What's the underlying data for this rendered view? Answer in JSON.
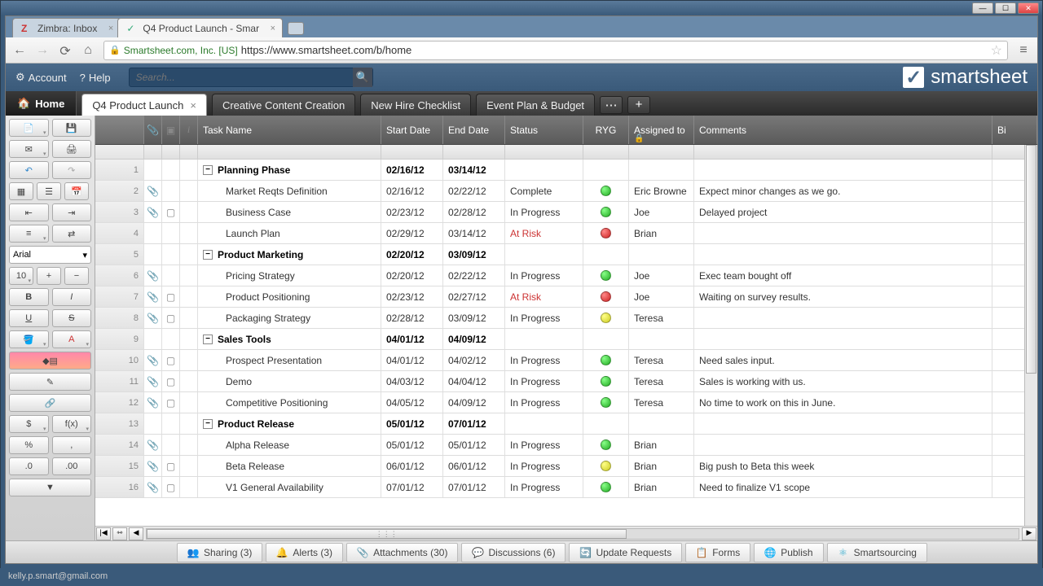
{
  "window": {
    "min": "—",
    "max": "☐",
    "close": "✕"
  },
  "browser_tabs": [
    {
      "title": "Zimbra: Inbox",
      "active": false,
      "icon": "Z"
    },
    {
      "title": "Q4 Product Launch - Smar",
      "active": true,
      "icon": "✓"
    }
  ],
  "nav": {
    "back": "←",
    "fwd": "→",
    "reload": "⟳",
    "home": "⌂"
  },
  "url": {
    "ev": "Smartsheet.com, Inc. [US]",
    "addr": "https://www.smartsheet.com/b/home"
  },
  "app_top": {
    "account": "Account",
    "help": "Help",
    "search_placeholder": "Search...",
    "logo": "smartsheet"
  },
  "sheet_tabs": {
    "home": "Home",
    "tabs": [
      {
        "label": "Q4 Product Launch",
        "active": true
      },
      {
        "label": "Creative Content Creation",
        "active": false
      },
      {
        "label": "New Hire Checklist",
        "active": false
      },
      {
        "label": "Event Plan & Budget",
        "active": false
      }
    ]
  },
  "toolbar": {
    "font": "Arial",
    "size": "10",
    "bold": "B",
    "italic": "I",
    "underline": "U",
    "strike": "S",
    "currency": "$",
    "fx": "f(x)",
    "percent": "%",
    "comma": ",",
    "dec_dec": ".0",
    "dec_inc": ".00",
    "link": "🔗",
    "highlight": "✎",
    "arrow": "▾"
  },
  "columns": {
    "rownum": "",
    "attach": "📎",
    "discuss": "▣",
    "info": "i",
    "task": "Task Name",
    "start": "Start Date",
    "end": "End Date",
    "status": "Status",
    "ryg": "RYG",
    "assigned": "Assigned to",
    "comments": "Comments",
    "extra": "Bi"
  },
  "rows": [
    {
      "n": 1,
      "parent": true,
      "task": "Planning Phase",
      "start": "02/16/12",
      "end": "03/14/12"
    },
    {
      "n": 2,
      "att": true,
      "task": "Market Reqts Definition",
      "start": "02/16/12",
      "end": "02/22/12",
      "status": "Complete",
      "ryg": "g",
      "assigned": "Eric Browne",
      "comment": "Expect minor changes as we go."
    },
    {
      "n": 3,
      "att": true,
      "disc": true,
      "task": "Business Case",
      "start": "02/23/12",
      "end": "02/28/12",
      "status": "In Progress",
      "ryg": "g",
      "assigned": "Joe",
      "comment": "Delayed project"
    },
    {
      "n": 4,
      "task": "Launch Plan",
      "start": "02/29/12",
      "end": "03/14/12",
      "status": "At Risk",
      "risk": true,
      "ryg": "r",
      "assigned": "Brian"
    },
    {
      "n": 5,
      "parent": true,
      "task": "Product Marketing",
      "start": "02/20/12",
      "end": "03/09/12"
    },
    {
      "n": 6,
      "att": true,
      "task": "Pricing Strategy",
      "start": "02/20/12",
      "end": "02/22/12",
      "status": "In Progress",
      "ryg": "g",
      "assigned": "Joe",
      "comment": "Exec team bought off"
    },
    {
      "n": 7,
      "att": true,
      "disc": true,
      "task": "Product Positioning",
      "start": "02/23/12",
      "end": "02/27/12",
      "status": "At Risk",
      "risk": true,
      "ryg": "r",
      "assigned": "Joe",
      "comment": "Waiting on survey results."
    },
    {
      "n": 8,
      "att": true,
      "disc": true,
      "task": "Packaging Strategy",
      "start": "02/28/12",
      "end": "03/09/12",
      "status": "In Progress",
      "ryg": "y",
      "assigned": "Teresa"
    },
    {
      "n": 9,
      "parent": true,
      "task": "Sales Tools",
      "start": "04/01/12",
      "end": "04/09/12"
    },
    {
      "n": 10,
      "att": true,
      "disc": true,
      "task": "Prospect Presentation",
      "start": "04/01/12",
      "end": "04/02/12",
      "status": "In Progress",
      "ryg": "g",
      "assigned": "Teresa",
      "comment": "Need sales input."
    },
    {
      "n": 11,
      "att": true,
      "disc": true,
      "task": "Demo",
      "start": "04/03/12",
      "end": "04/04/12",
      "status": "In Progress",
      "ryg": "g",
      "assigned": "Teresa",
      "comment": "Sales is working with us."
    },
    {
      "n": 12,
      "att": true,
      "disc": true,
      "task": "Competitive Positioning",
      "start": "04/05/12",
      "end": "04/09/12",
      "status": "In Progress",
      "ryg": "g",
      "assigned": "Teresa",
      "comment": "No time to work on this in June."
    },
    {
      "n": 13,
      "parent": true,
      "task": "Product Release",
      "start": "05/01/12",
      "end": "07/01/12"
    },
    {
      "n": 14,
      "att": true,
      "task": "Alpha Release",
      "start": "05/01/12",
      "end": "05/01/12",
      "status": "In Progress",
      "ryg": "g",
      "assigned": "Brian"
    },
    {
      "n": 15,
      "att": true,
      "disc": true,
      "task": "Beta Release",
      "start": "06/01/12",
      "end": "06/01/12",
      "status": "In Progress",
      "ryg": "y",
      "assigned": "Brian",
      "comment": "Big push to Beta this week"
    },
    {
      "n": 16,
      "att": true,
      "disc": true,
      "task": "V1 General Availability",
      "start": "07/01/12",
      "end": "07/01/12",
      "status": "In Progress",
      "ryg": "g",
      "assigned": "Brian",
      "comment": "Need to finalize V1 scope"
    }
  ],
  "bottom": {
    "sharing": "Sharing  (3)",
    "alerts": "Alerts  (3)",
    "attachments": "Attachments  (30)",
    "discussions": "Discussions  (6)",
    "update": "Update Requests",
    "forms": "Forms",
    "publish": "Publish",
    "smartsourcing": "Smartsourcing"
  },
  "status": "kelly.p.smart@gmail.com"
}
